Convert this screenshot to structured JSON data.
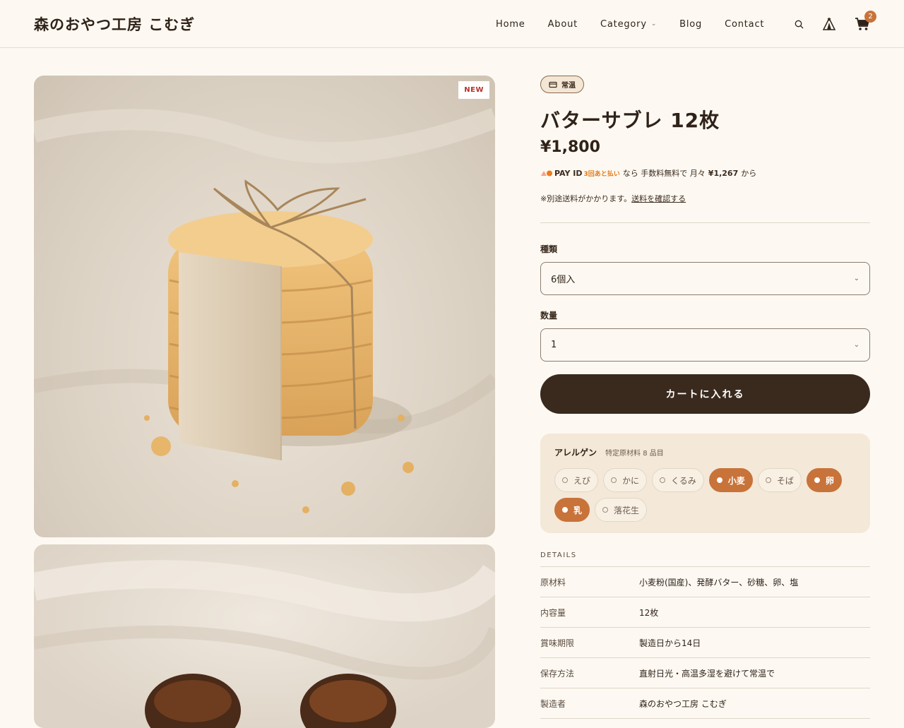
{
  "header": {
    "logo": "森のおやつ工房 こむぎ",
    "nav": [
      {
        "label": "Home"
      },
      {
        "label": "About"
      },
      {
        "label": "Category",
        "has_dropdown": true
      },
      {
        "label": "Blog"
      },
      {
        "label": "Contact"
      }
    ],
    "cart_count": "2",
    "icons": [
      "search-icon",
      "tent-icon",
      "cart-icon"
    ]
  },
  "gallery": {
    "badge": "NEW"
  },
  "product": {
    "storage_badge": "常温",
    "title": "バターサブレ 12枚",
    "price": "¥1,800",
    "pay": {
      "logo_text": "PAY ID",
      "logo_sub": "3回あと払い",
      "text_1": "なら 手数料無料で 月々",
      "amount": "¥1,267",
      "text_2": "から"
    },
    "shipping": {
      "text": "※別途送料がかかります。",
      "link": "送料を確認する"
    },
    "variant": {
      "label": "種類",
      "value": "6個入"
    },
    "quantity": {
      "label": "数量",
      "value": "1"
    },
    "cart_button": "カートに入れる",
    "allergens": {
      "title": "アレルゲン",
      "subtitle": "特定原材料 8 品目",
      "items": [
        {
          "label": "えび",
          "active": false
        },
        {
          "label": "かに",
          "active": false
        },
        {
          "label": "くるみ",
          "active": false
        },
        {
          "label": "小麦",
          "active": true
        },
        {
          "label": "そば",
          "active": false
        },
        {
          "label": "卵",
          "active": true
        },
        {
          "label": "乳",
          "active": true
        },
        {
          "label": "落花生",
          "active": false
        }
      ]
    },
    "details": {
      "heading": "DETAILS",
      "rows": [
        {
          "key": "原材料",
          "value": "小麦粉(国産)、発酵バター、砂糖、卵、塩"
        },
        {
          "key": "内容量",
          "value": "12枚"
        },
        {
          "key": "賞味期限",
          "value": "製造日から14日"
        },
        {
          "key": "保存方法",
          "value": "直射日光・高温多湿を避けて常温で"
        },
        {
          "key": "製造者",
          "value": "森のおやつ工房 こむぎ"
        }
      ]
    }
  },
  "colors": {
    "background": "#fdf9f2",
    "accent": "#c8733a",
    "dark": "#3a2a1e",
    "allergen_bg": "#f4e8d8"
  }
}
